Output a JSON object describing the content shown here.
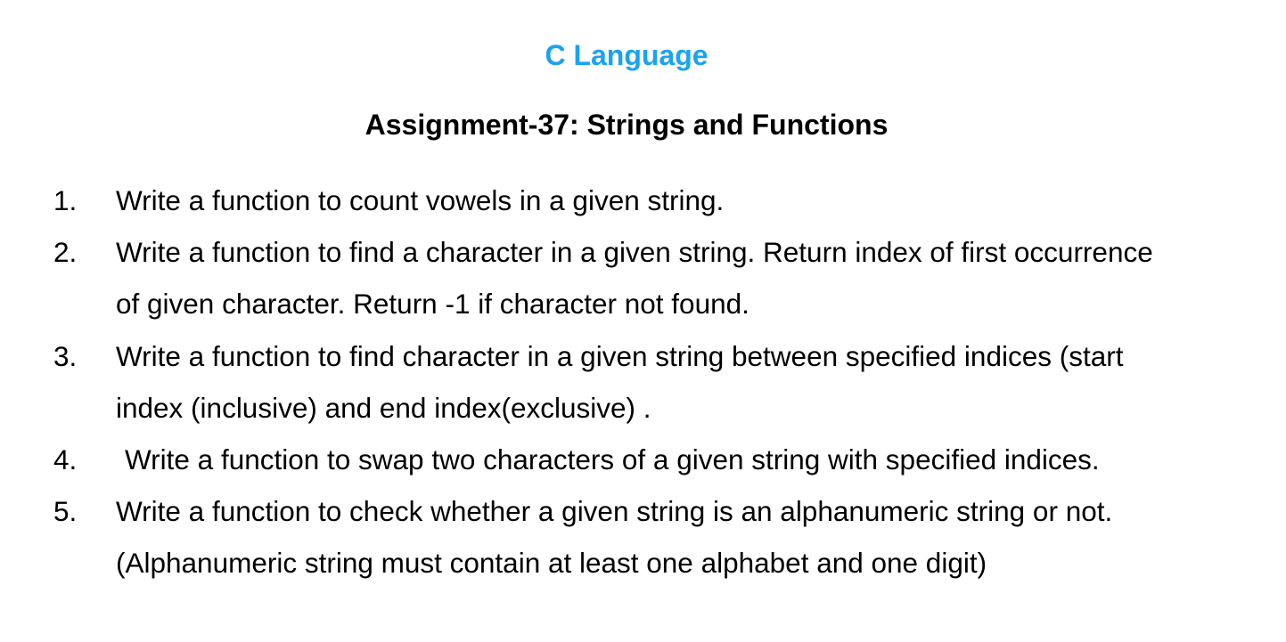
{
  "header": {
    "course_title": "C Language",
    "assignment_title": "Assignment-37: Strings and Functions"
  },
  "tasks": [
    {
      "number": "1.",
      "lines": [
        "Write a function to count vowels in a given string."
      ]
    },
    {
      "number": "2.",
      "lines": [
        "Write a function to find a character in a given string. Return index of first occurrence",
        "of given character. Return -1 if character not found."
      ]
    },
    {
      "number": "3.",
      "lines": [
        "Write a function to find character in a given string between specified indices (start",
        "index (inclusive) and end index(exclusive) ."
      ]
    },
    {
      "number": "4.",
      "lines": [
        "Write a function to swap two characters of a given string with specified indices."
      ]
    },
    {
      "number": "5.",
      "lines": [
        "Write a function to check whether a given string is an alphanumeric string or not.",
        "(Alphanumeric string must contain at least one alphabet and one digit)"
      ]
    }
  ]
}
